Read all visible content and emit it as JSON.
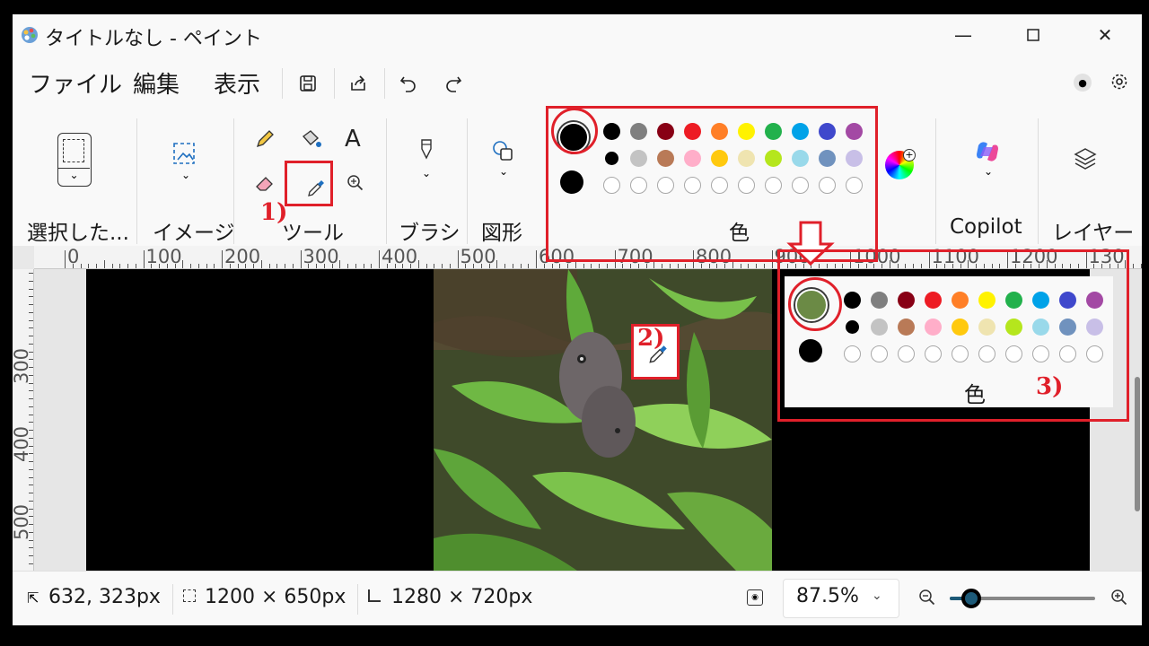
{
  "title": "タイトルなし - ペイント",
  "menu": {
    "file": "ファイル",
    "edit": "編集",
    "view": "表示"
  },
  "ribbon": {
    "select": "選択した...",
    "image": "イメージ",
    "tools": "ツール",
    "brush": "ブラシ",
    "shapes": "図形",
    "colors": "色",
    "copilot": "Copilot",
    "layers": "レイヤー"
  },
  "palette": {
    "primary": "#000000",
    "secondary": "#000000",
    "row1": [
      "#000000",
      "#7f7f7f",
      "#880015",
      "#ed1c24",
      "#ff7f27",
      "#fff200",
      "#22b14c",
      "#00a2e8",
      "#3f48cc",
      "#a349a4"
    ],
    "row2": [
      "#000000",
      "#c3c3c3",
      "#b97a57",
      "#ffaec9",
      "#ffc90e",
      "#efe4b0",
      "#b5e61d",
      "#99d9ea",
      "#7092be",
      "#c8bfe7"
    ]
  },
  "popup_palette": {
    "primary": "#6b8a45",
    "secondary": "#000000",
    "label": "色"
  },
  "ruler": {
    "top": [
      "0",
      "100",
      "200",
      "300",
      "400",
      "500",
      "600",
      "700",
      "800",
      "900",
      "1000",
      "1100",
      "1200",
      "130"
    ],
    "left": [
      "300",
      "400",
      "500"
    ]
  },
  "status": {
    "cursor": "632, 323px",
    "selection": "1200 × 650px",
    "canvas": "1280 × 720px",
    "zoom": "87.5%",
    "zoom_level": 0.15
  },
  "annotations": {
    "a1": "1)",
    "a2": "2)",
    "a3": "3)"
  }
}
